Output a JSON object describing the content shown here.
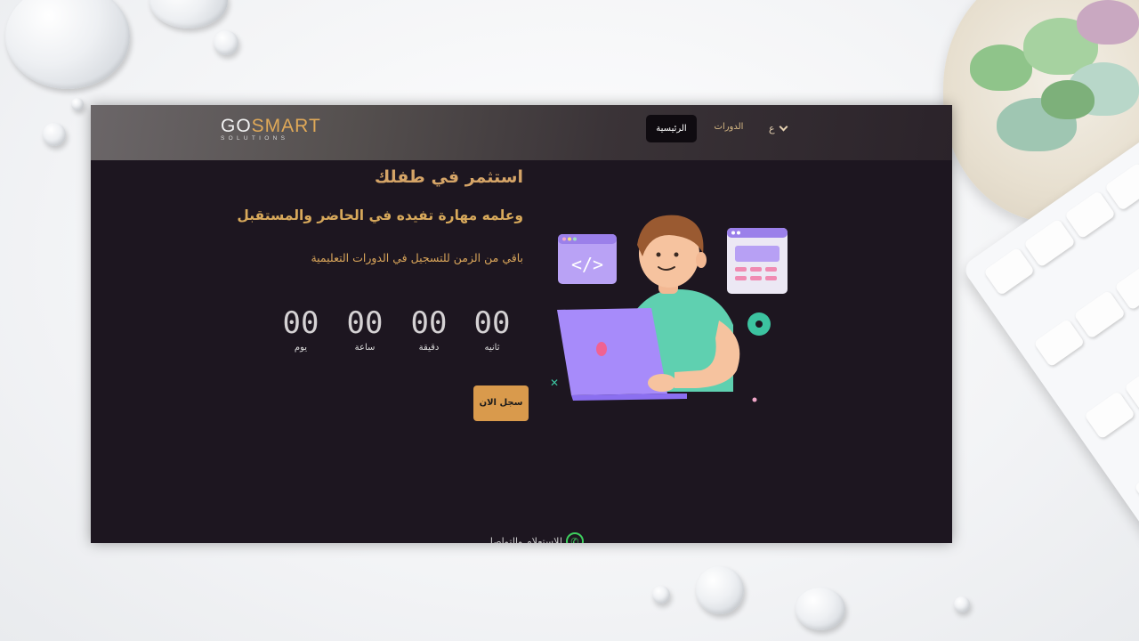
{
  "navbar": {
    "logo_main_left": "GO",
    "logo_main_right": "SMART",
    "logo_sub": "SOLUTIONS",
    "home_label": "الرئيسية",
    "courses_label": "الدورات",
    "lang_label": "ع"
  },
  "hero": {
    "heading": "استثمر في طفلك",
    "subheading": "وعلمه مهارة تفيده في الحاضر والمستقبل",
    "tagline": "باقي من الزمن للتسجيل في الدورات التعليمية"
  },
  "countdown": {
    "seconds": {
      "value": "00",
      "label": "ثانيه"
    },
    "minutes": {
      "value": "00",
      "label": "دقيقة"
    },
    "hours": {
      "value": "00",
      "label": "ساعة"
    },
    "days": {
      "value": "00",
      "label": "يوم"
    }
  },
  "register_label": "سجل الان",
  "footer": {
    "contact_label": "للاستعلام والتواصل"
  },
  "icons": {
    "language_dropdown": "chevron-down-icon",
    "contact": "whatsapp-icon",
    "code_window": "code-window-icon",
    "settings": "gear-icon"
  },
  "colors": {
    "page_background": "#1d1620",
    "accent_gold": "#d99a4c",
    "heading_gold": "#d5a467",
    "illustration_purple": "#a78bfa",
    "whatsapp_green": "#3ecf5e"
  }
}
